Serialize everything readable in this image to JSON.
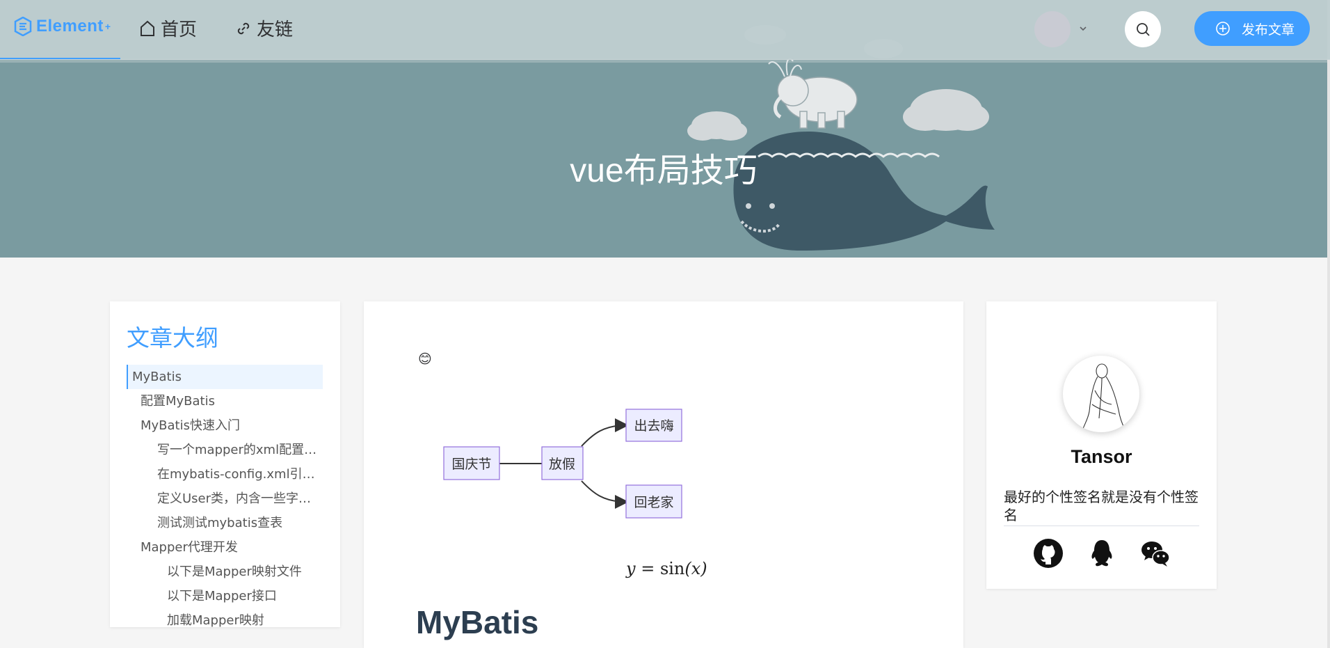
{
  "nav": {
    "logo_text": "Element",
    "logo_sup": "+",
    "home_label": "首页",
    "links_label": "友链",
    "publish_label": "发布文章",
    "accent_color": "#409eff"
  },
  "banner": {
    "title": "vue布局技巧"
  },
  "toc": {
    "title": "文章大纲",
    "items": [
      {
        "label": "MyBatis",
        "level": 1
      },
      {
        "label": "配置MyBatis",
        "level": 2
      },
      {
        "label": "MyBatis快速入门",
        "level": 2
      },
      {
        "label": "写一个mapper的xml配置文件",
        "level": 3
      },
      {
        "label": "在mybatis-config.xml引入mapper",
        "level": 3
      },
      {
        "label": "定义User类，内含一些字段与方法",
        "level": 3
      },
      {
        "label": "测试测试mybatis查表",
        "level": 3
      },
      {
        "label": "Mapper代理开发",
        "level": 2
      },
      {
        "label": "以下是Mapper映射文件",
        "level": 4
      },
      {
        "label": "以下是Mapper接口",
        "level": 4
      },
      {
        "label": "加载Mapper映射",
        "level": 4
      }
    ]
  },
  "article": {
    "emoji": "😊",
    "flow": {
      "start": "国庆节",
      "middle": "放假",
      "top": "出去嗨",
      "bottom": "回老家"
    },
    "formula_lhs": "y",
    "formula_eq": " = ",
    "formula_fn": "sin",
    "formula_arg": "(x)",
    "heading": "MyBatis"
  },
  "profile": {
    "name": "Tansor",
    "signature": "最好的个性签名就是没有个性签名"
  }
}
